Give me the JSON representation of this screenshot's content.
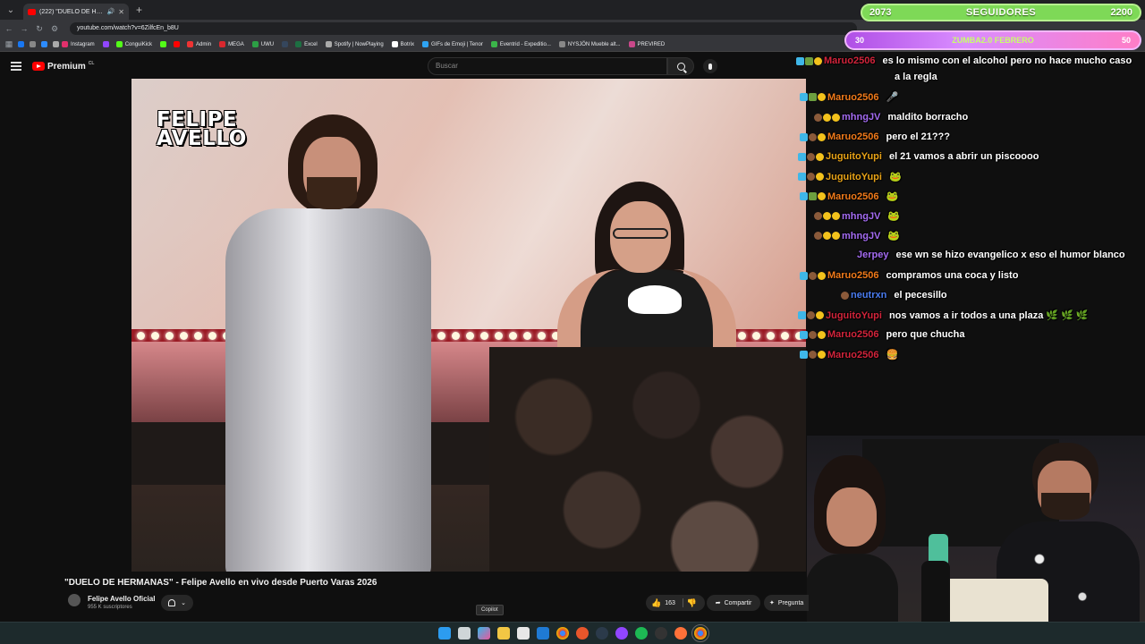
{
  "browser": {
    "tab_title": "(222) \"DUELO DE HERMANA",
    "new_tab": "+",
    "url": "youtube.com/watch?v=6ZilfcEn_b8U",
    "bookmarks": [
      "Instagram",
      "ConguiKick",
      "Admin",
      "MEGA",
      "UWU",
      "Excel",
      "Spotify | NowPlaying",
      "Botrix",
      "GIFs de Emoji | Tenor",
      "Eventrid - Expeditio...",
      "NYSJÖN Mueble alt...",
      "PREVIRED"
    ]
  },
  "followers": {
    "current": "2073",
    "label": "SEGUIDORES",
    "goal": "2200"
  },
  "zumba": {
    "left": "30",
    "label": "ZUMBA2.0 FEBRERO",
    "right": "50"
  },
  "youtube": {
    "premium_label": "Premium",
    "country": "CL",
    "search_placeholder": "Buscar"
  },
  "overlay_logo": {
    "line1": "FELIPE",
    "line2": "AVELLO"
  },
  "chat": [
    {
      "user": "Maruo2506",
      "text": "es lo mismo con el alcohol pero no hace mucho caso",
      "color": "u-red"
    },
    {
      "user": "",
      "text": "a la regla",
      "color": "u-red"
    },
    {
      "user": "Maruo2506",
      "text": "🎤",
      "color": "u-orange"
    },
    {
      "user": "mhngJV",
      "text": "maldito borracho",
      "color": "u-purple"
    },
    {
      "user": "Maruo2506",
      "text": "pero el 21???",
      "color": "u-orange"
    },
    {
      "user": "JuguitoYupi",
      "text": "el 21 vamos a abrir un piscoooo",
      "color": "u-gold"
    },
    {
      "user": "JuguitoYupi",
      "text": "🐸",
      "color": "u-gold"
    },
    {
      "user": "Maruo2506",
      "text": "🐸",
      "color": "u-orange"
    },
    {
      "user": "mhngJV",
      "text": "🐸",
      "color": "u-purple"
    },
    {
      "user": "mhngJV",
      "text": "🐸",
      "color": "u-purple"
    },
    {
      "user": "Jerpey",
      "text": "ese wn se hizo evangelico x eso el humor blanco",
      "color": "u-purple"
    },
    {
      "user": "Maruo2506",
      "text": "compramos una coca y listo",
      "color": "u-orange"
    },
    {
      "user": "neutrxn",
      "text": "el pecesillo",
      "color": "u-blue"
    },
    {
      "user": "JuguitoYupi",
      "text": "nos vamos a ir todos a una plaza 🌿 🌿 🌿",
      "color": "u-red"
    },
    {
      "user": "Maruo2506",
      "text": "pero que chucha",
      "color": "u-red"
    },
    {
      "user": "Maruo2506",
      "text": "🍔",
      "color": "u-red"
    }
  ],
  "video": {
    "title": "\"DUELO DE HERMANAS\" - Felipe Avello en vivo desde Puerto Varas 2026",
    "channel": "Felipe Avello Oficial",
    "subscribers": "955 K suscriptores",
    "likes": "163",
    "share": "Compartir",
    "ask": "Pregunta"
  },
  "tooltip": "Copilot",
  "colors": {
    "youtube_red": "#ff0000",
    "followers_green": "#7ed957",
    "zumba_pink": "#d98cff"
  }
}
